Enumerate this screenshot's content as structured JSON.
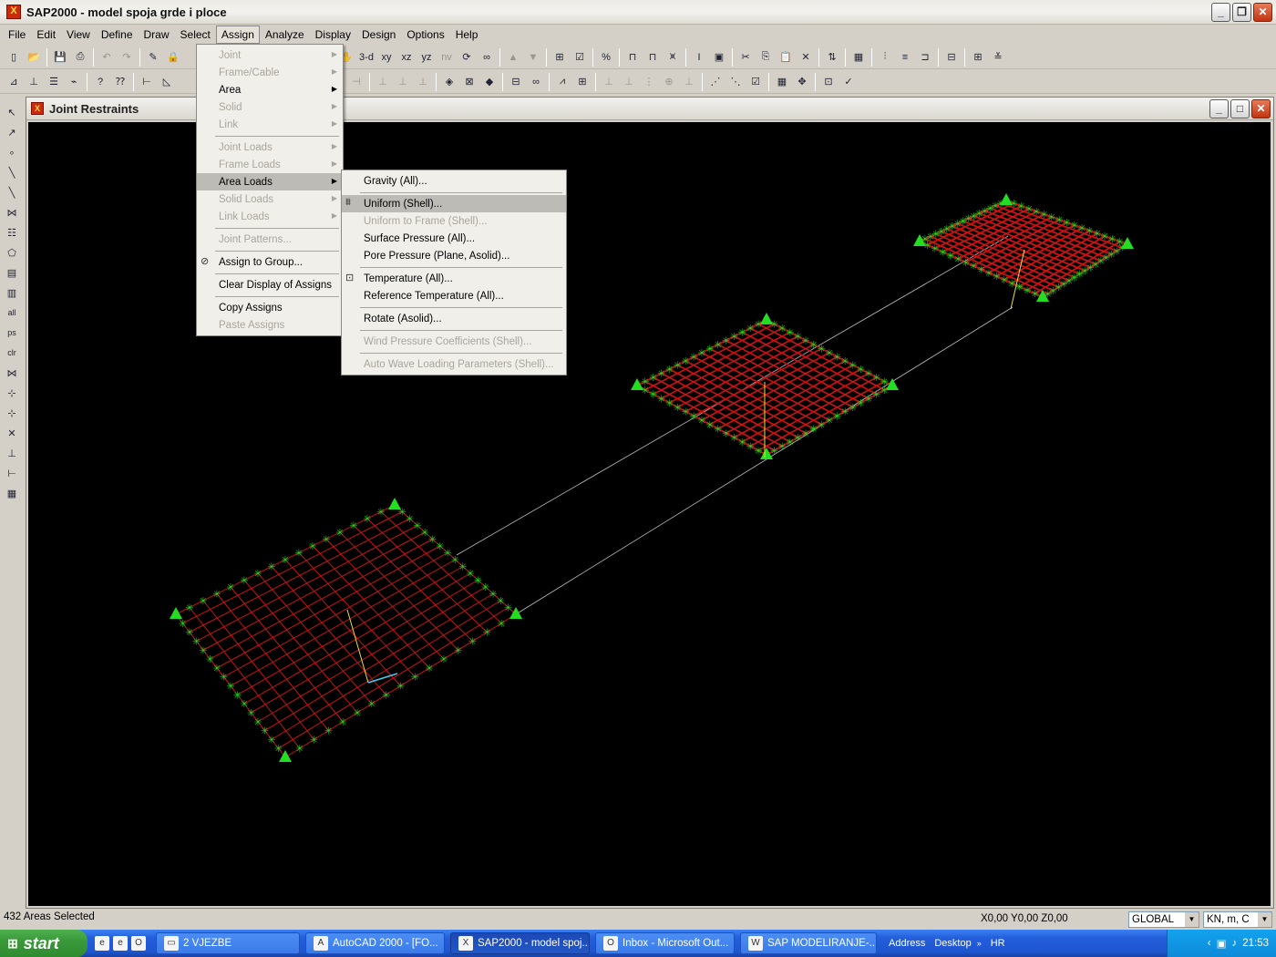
{
  "window": {
    "title": "SAP2000 - model spoja grde i ploce"
  },
  "menubar": [
    "File",
    "Edit",
    "View",
    "Define",
    "Draw",
    "Select",
    "Assign",
    "Analyze",
    "Display",
    "Design",
    "Options",
    "Help"
  ],
  "toolbar1_labels": {
    "view3d": "3-d",
    "xy": "xy",
    "xz": "xz",
    "yz": "yz",
    "nv": "nv"
  },
  "child": {
    "title": "Joint Restraints"
  },
  "assign_menu": [
    {
      "label": "Joint",
      "enabled": false,
      "submenu": true
    },
    {
      "label": "Frame/Cable",
      "enabled": false,
      "submenu": true
    },
    {
      "label": "Area",
      "enabled": true,
      "submenu": true
    },
    {
      "label": "Solid",
      "enabled": false,
      "submenu": true
    },
    {
      "label": "Link",
      "enabled": false,
      "submenu": true
    },
    {
      "sep": true
    },
    {
      "label": "Joint Loads",
      "enabled": false,
      "submenu": true
    },
    {
      "label": "Frame Loads",
      "enabled": false,
      "submenu": true
    },
    {
      "label": "Area Loads",
      "enabled": true,
      "submenu": true,
      "highlight": true
    },
    {
      "label": "Solid Loads",
      "enabled": false,
      "submenu": true
    },
    {
      "label": "Link Loads",
      "enabled": false,
      "submenu": true
    },
    {
      "sep": true
    },
    {
      "label": "Joint Patterns...",
      "enabled": false
    },
    {
      "sep": true
    },
    {
      "label": "Assign to Group...",
      "enabled": true,
      "icon": "group-icon"
    },
    {
      "sep": true
    },
    {
      "label": "Clear Display of Assigns",
      "enabled": true
    },
    {
      "sep": true
    },
    {
      "label": "Copy Assigns",
      "enabled": true
    },
    {
      "label": "Paste Assigns",
      "enabled": false
    }
  ],
  "area_loads_menu": [
    {
      "label": "Gravity (All)...",
      "enabled": true
    },
    {
      "sep": true
    },
    {
      "label": "Uniform (Shell)...",
      "enabled": true,
      "highlight": true,
      "icon": "uniform-load-icon"
    },
    {
      "label": "Uniform to Frame (Shell)...",
      "enabled": false
    },
    {
      "label": "Surface Pressure (All)...",
      "enabled": true
    },
    {
      "label": "Pore Pressure (Plane, Asolid)...",
      "enabled": true
    },
    {
      "sep": true
    },
    {
      "label": "Temperature (All)...",
      "enabled": true,
      "icon": "temperature-icon"
    },
    {
      "label": "Reference Temperature (All)...",
      "enabled": true
    },
    {
      "sep": true
    },
    {
      "label": "Rotate (Asolid)...",
      "enabled": true
    },
    {
      "sep": true
    },
    {
      "label": "Wind Pressure Coefficients (Shell)...",
      "enabled": false
    },
    {
      "sep": true
    },
    {
      "label": "Auto Wave Loading Parameters (Shell)...",
      "enabled": false
    }
  ],
  "status": {
    "selection": "432 Areas Selected",
    "coords": "X0,00  Y0,00  Z0,00",
    "coord_system": "GLOBAL",
    "units": "KN, m, C"
  },
  "taskbar": {
    "start": "start",
    "tasks": [
      {
        "label": "2 VJEZBE",
        "icon": "folder-icon"
      },
      {
        "label": "AutoCAD 2000 - [FO...",
        "icon": "autocad-icon"
      },
      {
        "label": "SAP2000 - model spoj...",
        "icon": "sap2000-icon",
        "active": true
      },
      {
        "label": "Inbox - Microsoft Out...",
        "icon": "outlook-icon"
      },
      {
        "label": "SAP  MODELIRANJE-...",
        "icon": "word-icon"
      }
    ],
    "address": "Address",
    "desktop": "Desktop",
    "lang": "HR",
    "clock": "21:53"
  },
  "colors": {
    "mesh": "#c81414",
    "support": "#22dd22",
    "axis": "#e8e040",
    "frame": "#c0c0c0",
    "viewport_bg": "#000000"
  }
}
